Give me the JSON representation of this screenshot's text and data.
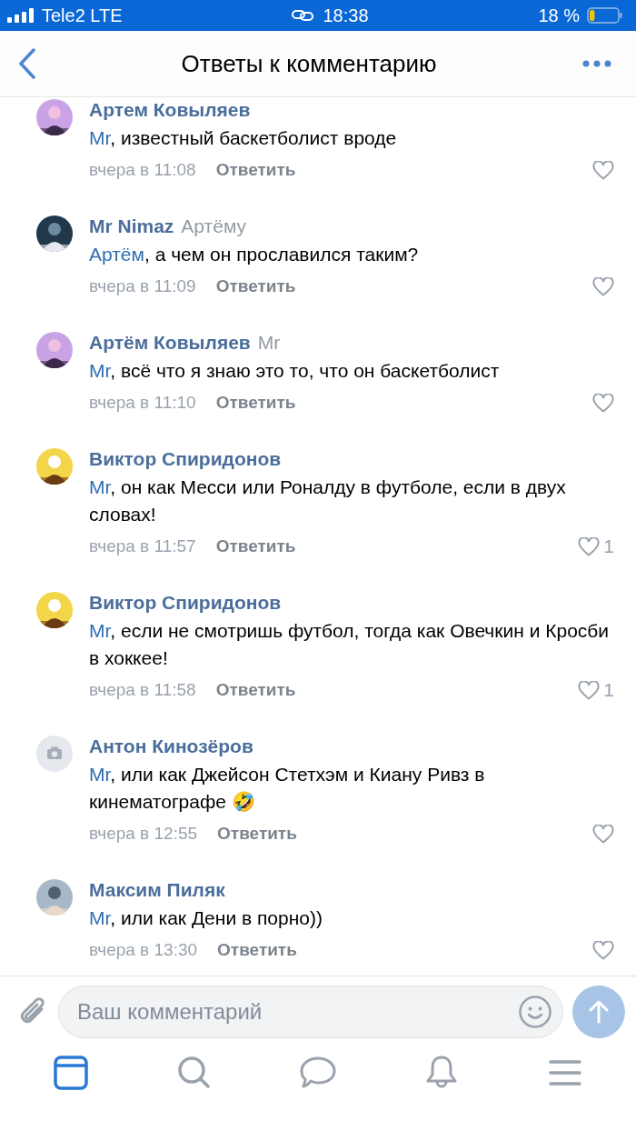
{
  "status_bar": {
    "carrier": "Tele2 LTE",
    "time": "18:38",
    "battery": "18 %"
  },
  "header": {
    "title": "Ответы к комментарию"
  },
  "comments": [
    {
      "author": "Артем Ковыляев",
      "mention": "Mr",
      "text": ", известный баскетболист вроде",
      "time": "вчера в 11:08",
      "reply": "Ответить",
      "kind": "picture"
    },
    {
      "author": "Mr Nimaz",
      "reply_to": "Артёму",
      "mention": "Артём",
      "text": ", а чем он прославился таким?",
      "time": "вчера в 11:09",
      "reply": "Ответить",
      "kind": "picture"
    },
    {
      "author": "Артём Ковыляев",
      "reply_to": "Mr",
      "mention": "Mr",
      "text": ", всё что я знаю это то, что он баскетболист",
      "time": "вчера в 11:10",
      "reply": "Ответить",
      "kind": "picture"
    },
    {
      "author": "Виктор Спиридонов",
      "mention": "Mr",
      "text": ", он как Месси или Роналду в футболе, если в двух словах!",
      "time": "вчера в 11:57",
      "reply": "Ответить",
      "likes": "1",
      "kind": "picture"
    },
    {
      "author": "Виктор Спиридонов",
      "mention": "Mr",
      "text": ", если не смотришь футбол, тогда как Овечкин и Кросби в хоккее!",
      "time": "вчера в 11:58",
      "reply": "Ответить",
      "likes": "1",
      "kind": "picture"
    },
    {
      "author": "Антон Кинозёров",
      "mention": "Mr",
      "text": ", или как Джейсон Стетхэм и Киану Ривз в кинематографе 🤣",
      "time": "вчера в 12:55",
      "reply": "Ответить",
      "kind": "placeholder"
    },
    {
      "author": "Максим Пиляк",
      "mention": "Mr",
      "text": ", или как Дени в порно))",
      "time": "вчера в 13:30",
      "reply": "Ответить",
      "kind": "picture"
    }
  ],
  "composer": {
    "placeholder": "Ваш комментарий"
  },
  "tabs": [
    {
      "kind": "feed",
      "selected": true
    },
    {
      "kind": "search",
      "selected": false
    },
    {
      "kind": "messages",
      "selected": false
    },
    {
      "kind": "notifications",
      "selected": false
    },
    {
      "kind": "menu",
      "selected": false
    }
  ]
}
